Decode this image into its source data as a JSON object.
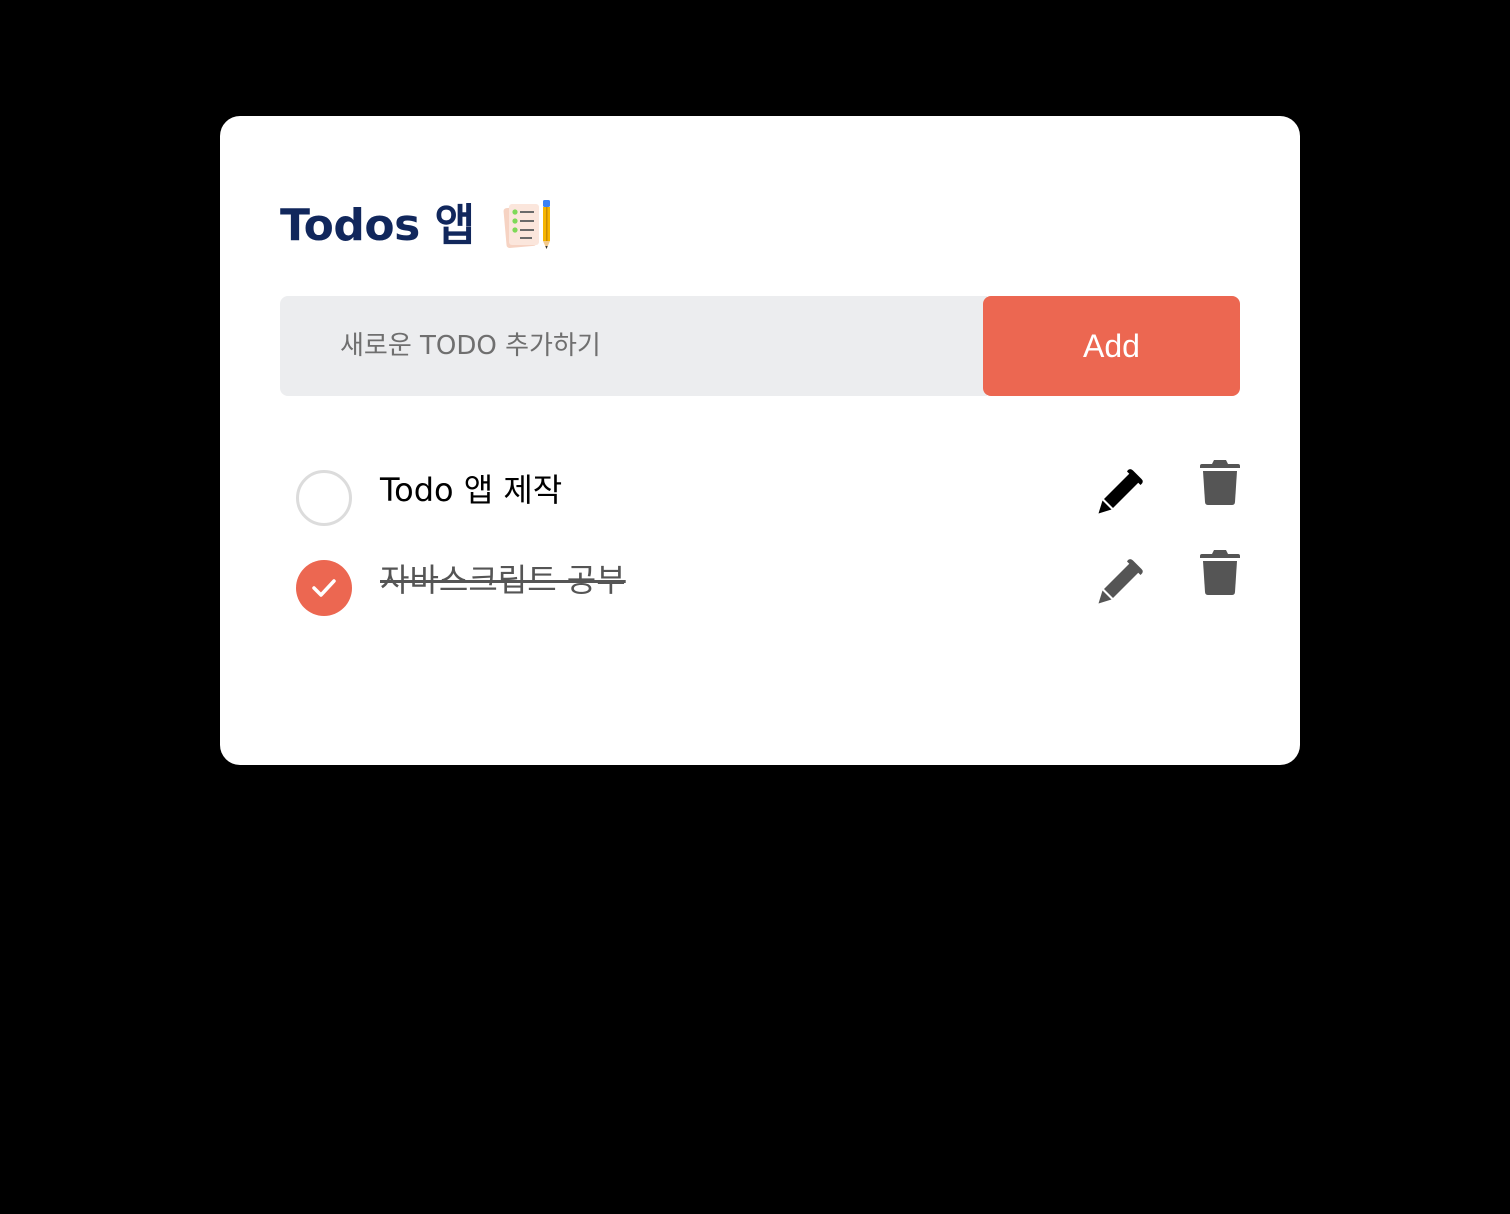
{
  "app": {
    "title": "Todos 앱",
    "title_icon": "notepad-pencil-icon"
  },
  "add_form": {
    "placeholder": "새로운 TODO 추가하기",
    "value": "",
    "button_label": "Add"
  },
  "todos": [
    {
      "text": "Todo 앱 제작",
      "completed": false
    },
    {
      "text": "자바스크립트 공부",
      "completed": true
    }
  ],
  "icons": {
    "edit": "pencil-icon",
    "delete": "trash-icon",
    "check": "checkmark-icon"
  },
  "colors": {
    "background": "#000000",
    "card": "#ffffff",
    "title": "#11275c",
    "accent": "#ec6751",
    "input_bg": "#ecedef",
    "active_icon": "#000000",
    "muted_icon": "#555555"
  }
}
